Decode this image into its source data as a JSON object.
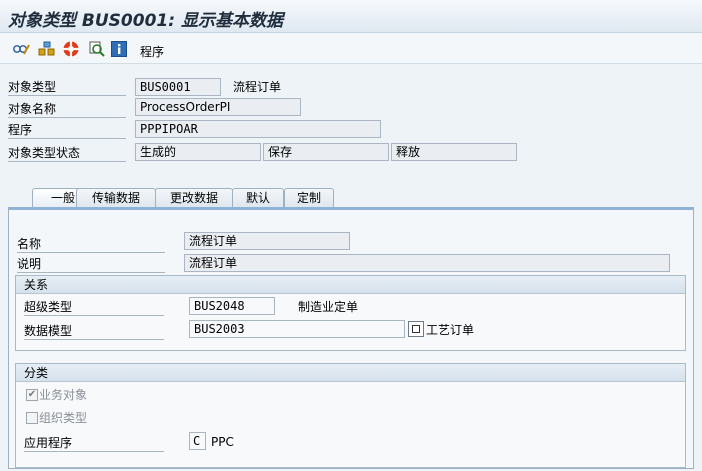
{
  "window": {
    "title": "对象类型 BUS0001: 显示基本数据"
  },
  "toolbar": {
    "buttons": [
      {
        "icon": "display-change-icon"
      },
      {
        "icon": "hierarchy-icon"
      },
      {
        "icon": "lifebuoy-icon"
      },
      {
        "icon": "where-used-icon"
      },
      {
        "icon": "info-icon"
      }
    ],
    "program_label": "程序"
  },
  "header": {
    "object_type_label": "对象类型",
    "object_type_value": "BUS0001",
    "object_type_desc": "流程订单",
    "object_name_label": "对象名称",
    "object_name_value": "ProcessOrderPI",
    "program_label": "程序",
    "program_value": "PPPIPOAR",
    "status_label": "对象类型状态",
    "status_values": [
      "生成的",
      "保存",
      "释放"
    ]
  },
  "tabs": [
    {
      "label": "一般"
    },
    {
      "label": "传输数据"
    },
    {
      "label": "更改数据"
    },
    {
      "label": "默认"
    },
    {
      "label": "定制"
    }
  ],
  "general": {
    "name_label": "名称",
    "name_value": "流程订单",
    "desc_label": "说明",
    "desc_value": "流程订单",
    "relations": {
      "title": "关系",
      "supertype_label": "超级类型",
      "supertype_value": "BUS2048",
      "supertype_desc": "制造业定单",
      "datamodel_label": "数据模型",
      "datamodel_value": "BUS2003",
      "datamodel_desc": "工艺订单"
    },
    "classification": {
      "title": "分类",
      "business_object_label": "业务对象",
      "business_object_checked": true,
      "org_type_label": "组织类型",
      "org_type_checked": false,
      "app_label": "应用程序",
      "app_value": "C",
      "app_desc": "PPC"
    }
  }
}
